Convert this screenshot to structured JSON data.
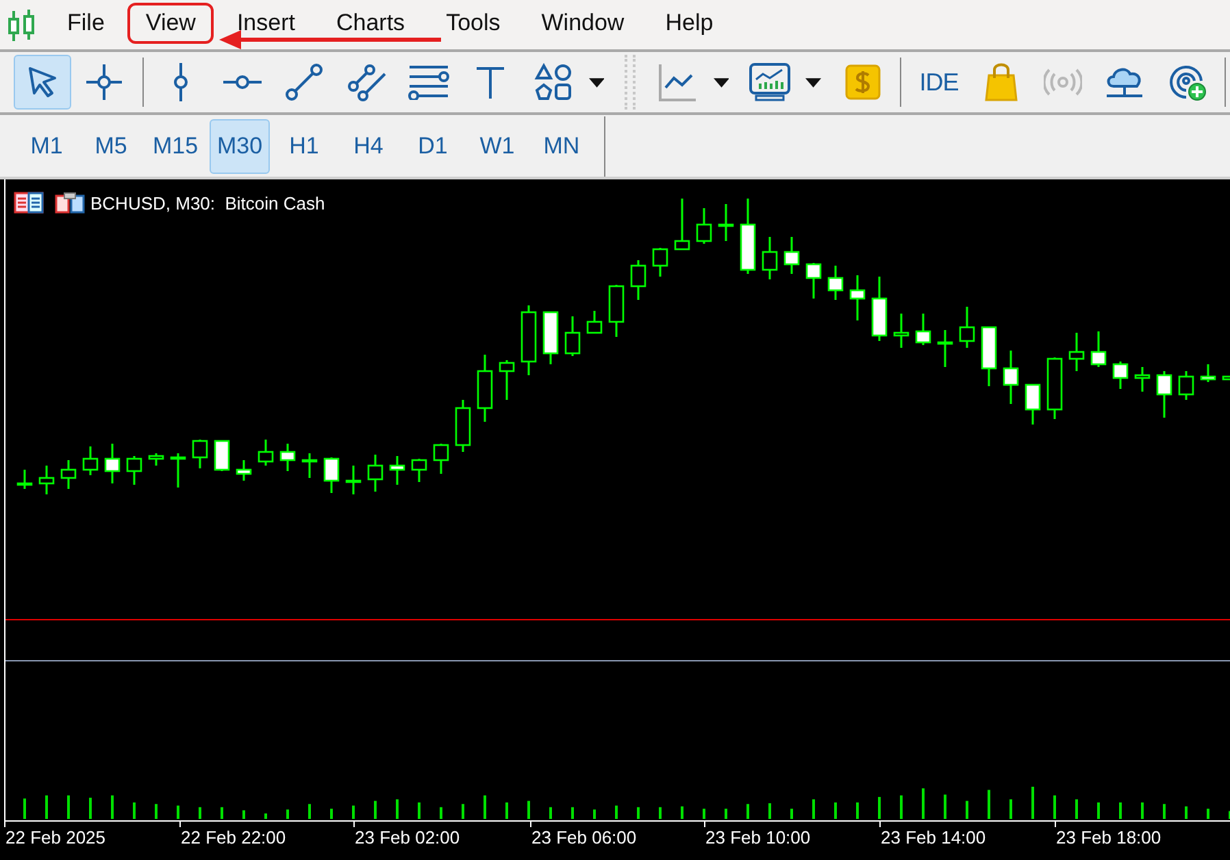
{
  "menu": [
    {
      "label": "File",
      "highlighted": false
    },
    {
      "label": "View",
      "highlighted": true
    },
    {
      "label": "Insert",
      "highlighted": false
    },
    {
      "label": "Charts",
      "highlighted": false
    },
    {
      "label": "Tools",
      "highlighted": false
    },
    {
      "label": "Window",
      "highlighted": false
    },
    {
      "label": "Help",
      "highlighted": false
    }
  ],
  "toolbar": [
    {
      "kind": "cursor",
      "selected": true
    },
    {
      "kind": "crosshair",
      "selected": false
    },
    {
      "kind": "separator"
    },
    {
      "kind": "vline",
      "selected": false
    },
    {
      "kind": "hline",
      "selected": false
    },
    {
      "kind": "trend",
      "selected": false
    },
    {
      "kind": "channel",
      "selected": false
    },
    {
      "kind": "fibo",
      "selected": false
    },
    {
      "kind": "text-tool",
      "selected": false
    },
    {
      "kind": "shapes",
      "selected": false
    },
    {
      "kind": "dropdown"
    },
    {
      "kind": "grip"
    },
    {
      "kind": "indicator",
      "selected": false
    },
    {
      "kind": "dropdown"
    },
    {
      "kind": "monitor",
      "selected": false
    },
    {
      "kind": "dropdown"
    },
    {
      "kind": "dollar",
      "selected": false
    },
    {
      "kind": "separator"
    },
    {
      "kind": "label",
      "label": "IDE",
      "selected": false
    },
    {
      "kind": "bag",
      "selected": false
    },
    {
      "kind": "signal",
      "selected": false,
      "disabled": true
    },
    {
      "kind": "cloud",
      "selected": false
    },
    {
      "kind": "radar",
      "selected": false
    },
    {
      "kind": "separator"
    }
  ],
  "timeframes": [
    {
      "label": "M1",
      "selected": false
    },
    {
      "label": "M5",
      "selected": false
    },
    {
      "label": "M15",
      "selected": false
    },
    {
      "label": "M30",
      "selected": true
    },
    {
      "label": "H1",
      "selected": false
    },
    {
      "label": "H4",
      "selected": false
    },
    {
      "label": "D1",
      "selected": false
    },
    {
      "label": "W1",
      "selected": false
    },
    {
      "label": "MN",
      "selected": false
    }
  ],
  "chart": {
    "title": "BCHUSD, M30:  Bitcoin Cash",
    "time_labels": [
      "22 Feb 2025",
      "22 Feb 22:00",
      "23 Feb 02:00",
      "23 Feb 06:00",
      "23 Feb 10:00",
      "23 Feb 14:00",
      "23 Feb 18:00"
    ]
  }
}
